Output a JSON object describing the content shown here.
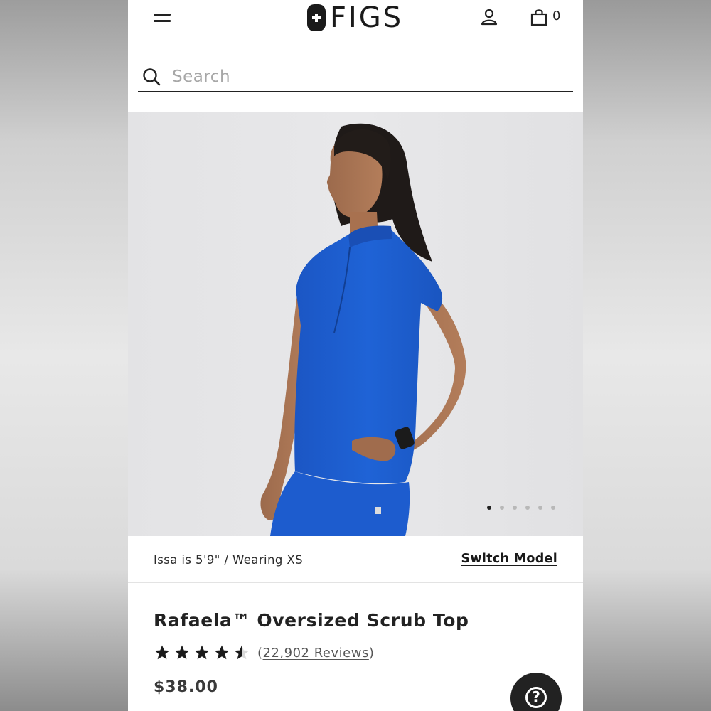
{
  "header": {
    "brand": "FIGS",
    "cart_count": "0"
  },
  "search": {
    "placeholder": "Search",
    "value": ""
  },
  "gallery": {
    "image_count": 6,
    "active_index": 0,
    "shirt_color": "#1f5fd1"
  },
  "model": {
    "info": "Issa is 5'9\" / Wearing XS",
    "switch_label": "Switch Model"
  },
  "product": {
    "title": "Rafaela™ Oversized Scrub Top",
    "rating": 4.5,
    "reviews_open": "(",
    "reviews_count": "22,902 Reviews",
    "reviews_close": ")",
    "price": "$38.00"
  },
  "help": {
    "icon": "question-icon",
    "glyph": "?"
  },
  "colors": {
    "accent": "#1a1a1a",
    "placeholder": "#a7a7a7"
  }
}
